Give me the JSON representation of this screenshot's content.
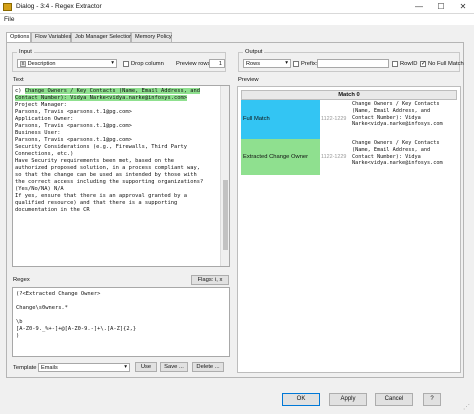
{
  "window": {
    "title": "Dialog - 3:4 - Regex Extractor",
    "minimize": "—",
    "maximize": "☐",
    "close": "✕"
  },
  "menu": {
    "file": "File"
  },
  "tabs": [
    {
      "label": "Options",
      "active": true
    },
    {
      "label": "Flow Variables",
      "active": false
    },
    {
      "label": "Job Manager Selection",
      "active": false
    },
    {
      "label": "Memory Policy",
      "active": false
    }
  ],
  "input": {
    "group_label": "Input",
    "column": "Description",
    "column_badge": "S",
    "drop_column_label": "Drop column",
    "preview_rows_label": "Preview rows:",
    "preview_rows_value": "1"
  },
  "output": {
    "group_label": "Output",
    "mode": "Rows",
    "prefix_label": "Prefix:",
    "prefix_value": "",
    "rowid_label": "RowID",
    "no_full_match_label": "No Full Match"
  },
  "text": {
    "label": "Text",
    "lines": [
      {
        "pre": "c) ",
        "hl": "Change Owners / Key Contacts (Name, Email Address, and",
        "post": ""
      },
      {
        "pre": "",
        "hl": "Contact Number): Vidya Narke<vidya.narke@infosys.com>",
        "post": ""
      },
      {
        "pre": "",
        "hl": "",
        "post": ""
      },
      {
        "pre": "Project Manager:",
        "hl": "",
        "post": ""
      },
      {
        "pre": "Parsons, Travis <parsons.t.1@pg.com>",
        "hl": "",
        "post": ""
      },
      {
        "pre": "",
        "hl": "",
        "post": ""
      },
      {
        "pre": "Application Owner:",
        "hl": "",
        "post": ""
      },
      {
        "pre": "Parsons, Travis <parsons.t.1@pg.com>",
        "hl": "",
        "post": ""
      },
      {
        "pre": "",
        "hl": "",
        "post": ""
      },
      {
        "pre": "Business User:",
        "hl": "",
        "post": ""
      },
      {
        "pre": "Parsons, Travis <parsons.t.1@pg.com>",
        "hl": "",
        "post": ""
      },
      {
        "pre": "",
        "hl": "",
        "post": ""
      },
      {
        "pre": "Security Considerations (e.g., Firewalls, Third Party",
        "hl": "",
        "post": ""
      },
      {
        "pre": "Connections, etc.)",
        "hl": "",
        "post": ""
      },
      {
        "pre": "Have Security requirements been met, based on the",
        "hl": "",
        "post": ""
      },
      {
        "pre": "authorized proposed solution, in a process compliant way,",
        "hl": "",
        "post": ""
      },
      {
        "pre": "so that the change can be used as intended by those with",
        "hl": "",
        "post": ""
      },
      {
        "pre": "the correct access including the supporting organizations?",
        "hl": "",
        "post": ""
      },
      {
        "pre": "(Yes/No/NA) N/A",
        "hl": "",
        "post": ""
      },
      {
        "pre": "If yes, ensure that there is an approval granted by a",
        "hl": "",
        "post": ""
      },
      {
        "pre": "qualified resource) and that there is a supporting",
        "hl": "",
        "post": ""
      },
      {
        "pre": "documentation in the CR",
        "hl": "",
        "post": ""
      }
    ]
  },
  "regex": {
    "label": "Regex",
    "flags_label": "Flags: i, x",
    "lines": [
      "(?<Extracted Change Owner>",
      "",
      "Change\\s0wners.*",
      "",
      "\\b",
      "[A-Z0-9._%+-]+@[A-Z0-9.-]+\\.[A-Z]{2,}",
      ")"
    ],
    "template_label": "Template",
    "template_value": "Emails",
    "use_label": "Use",
    "save_label": "Save ...",
    "delete_label": "Delete ..."
  },
  "preview": {
    "label": "Preview",
    "header": "Match 0",
    "rows": [
      {
        "name": "Full Match",
        "range": "1122-1229",
        "value": "Change Owners / Key Contacts\n(Name, Email Address, and\nContact Number): Vidya\nNarke<vidya.narke@infosys.com",
        "color": "#33c5f3"
      },
      {
        "name": "Extracted Change Owner",
        "range": "1122-1229",
        "value": "Change Owners / Key Contacts\n(Name, Email Address, and\nContact Number): Vidya\nNarke<vidya.narke@infosys.com",
        "color": "#8fe08f"
      }
    ]
  },
  "footer": {
    "ok": "OK",
    "apply": "Apply",
    "cancel": "Cancel",
    "help": "?"
  }
}
